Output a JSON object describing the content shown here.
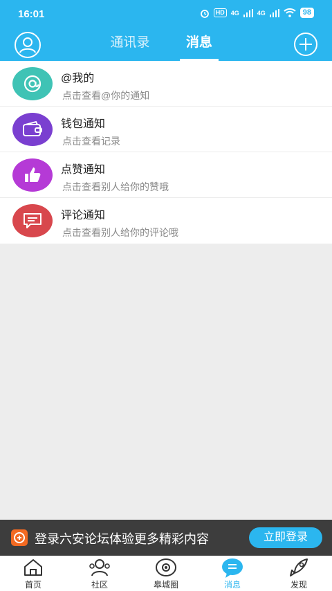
{
  "status_bar": {
    "time": "16:01",
    "network_1": "4G",
    "network_2": "4G",
    "hd": "HD",
    "battery": "98"
  },
  "header": {
    "tabs": [
      {
        "label": "通讯录",
        "active": false
      },
      {
        "label": "消息",
        "active": true
      }
    ]
  },
  "notifications": [
    {
      "title": "@我的",
      "subtitle": "点击查看@你的通知",
      "icon": "at-icon",
      "color": "#3fc3b5"
    },
    {
      "title": "钱包通知",
      "subtitle": "点击查看记录",
      "icon": "wallet-icon",
      "color": "#7a3fd0"
    },
    {
      "title": "点赞通知",
      "subtitle": "点击查看别人给你的赞哦",
      "icon": "thumbs-up-icon",
      "color": "#b53ad6"
    },
    {
      "title": "评论通知",
      "subtitle": "点击查看别人给你的评论哦",
      "icon": "comment-icon",
      "color": "#d8474d"
    }
  ],
  "banner": {
    "text": "登录六安论坛体验更多精彩内容",
    "button": "立即登录"
  },
  "bottom_nav": [
    {
      "label": "首页",
      "icon": "home-icon",
      "active": false
    },
    {
      "label": "社区",
      "icon": "community-icon",
      "active": false
    },
    {
      "label": "皋城圈",
      "icon": "circle-icon",
      "active": false
    },
    {
      "label": "消息",
      "icon": "message-icon",
      "active": true
    },
    {
      "label": "发现",
      "icon": "rocket-icon",
      "active": false
    }
  ],
  "colors": {
    "primary": "#2bb6ef",
    "banner_bg": "#3d3d3d",
    "background": "#ededed"
  }
}
